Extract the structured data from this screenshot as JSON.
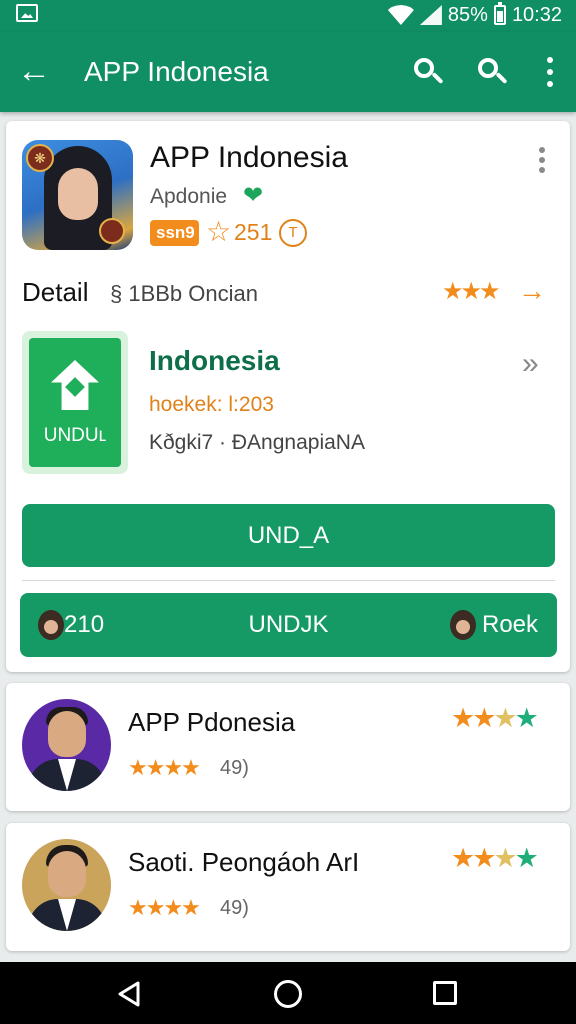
{
  "status_bar": {
    "battery_percent": "85%",
    "time": "10:32"
  },
  "app_bar": {
    "title": "APP Indonesia"
  },
  "app": {
    "name": "APP Indonesia",
    "developer": "Apdonie",
    "rating_pill": "ssn9",
    "rating_count": "251",
    "coin_symbol": "T"
  },
  "detail": {
    "label": "Detail",
    "sub": "§ 1BBb Oncian",
    "stars": "★★★",
    "arrow": "→"
  },
  "download_item": {
    "tile_label": "UNDUʟ",
    "title": "Indonesia",
    "version": "hoekek: l:203",
    "meta": "Kðgki7 · ÐAngnapiaNA",
    "chevron": "»"
  },
  "primary_button": {
    "label": "UND_A"
  },
  "secondary_bar": {
    "left": "210",
    "center": "UNDJK",
    "right": "Roek"
  },
  "list": [
    {
      "title": "APP Pdonesia",
      "stars": "★★★★",
      "score": "49)"
    },
    {
      "title": "Saoti. Peongáoh ArI",
      "stars": "★★★★",
      "score": "49)"
    }
  ],
  "colors": {
    "primary": "#0f8f63",
    "button": "#159a66",
    "accent_orange": "#f28c1c",
    "title_green": "#0d6e49"
  },
  "icons": [
    "back-arrow-icon",
    "search-icon",
    "more-vert-icon",
    "verified-heart-icon",
    "star-icon",
    "coin-icon",
    "download-icon",
    "chevron-right-icon",
    "nav-back-icon",
    "nav-home-icon",
    "nav-recents-icon"
  ]
}
